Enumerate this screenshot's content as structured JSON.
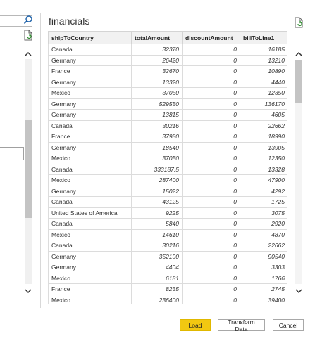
{
  "preview": {
    "title": "financials",
    "columns": [
      "shipToCountry",
      "totalAmount",
      "discountAmount",
      "billToLine1"
    ],
    "rows": [
      [
        "Canada",
        "32370",
        "0",
        "16185"
      ],
      [
        "Germany",
        "26420",
        "0",
        "13210"
      ],
      [
        "France",
        "32670",
        "0",
        "10890"
      ],
      [
        "Germany",
        "13320",
        "0",
        "4440"
      ],
      [
        "Mexico",
        "37050",
        "0",
        "12350"
      ],
      [
        "Germany",
        "529550",
        "0",
        "136170"
      ],
      [
        "Germany",
        "13815",
        "0",
        "4605"
      ],
      [
        "Canada",
        "30216",
        "0",
        "22662"
      ],
      [
        "France",
        "37980",
        "0",
        "18990"
      ],
      [
        "Germany",
        "18540",
        "0",
        "13905"
      ],
      [
        "Mexico",
        "37050",
        "0",
        "12350"
      ],
      [
        "Canada",
        "333187.5",
        "0",
        "13328"
      ],
      [
        "Mexico",
        "287400",
        "0",
        "47900"
      ],
      [
        "Germany",
        "15022",
        "0",
        "4292"
      ],
      [
        "Canada",
        "43125",
        "0",
        "1725"
      ],
      [
        "United States of America",
        "9225",
        "0",
        "3075"
      ],
      [
        "Canada",
        "5840",
        "0",
        "2920"
      ],
      [
        "Mexico",
        "14610",
        "0",
        "4870"
      ],
      [
        "Canada",
        "30216",
        "0",
        "22662"
      ],
      [
        "Germany",
        "352100",
        "0",
        "90540"
      ],
      [
        "Germany",
        "4404",
        "0",
        "3303"
      ],
      [
        "Mexico",
        "6181",
        "0",
        "1766"
      ],
      [
        "France",
        "8235",
        "0",
        "2745"
      ],
      [
        "Mexico",
        "236400",
        "0",
        "39400"
      ]
    ]
  },
  "buttons": {
    "load_label": "Load",
    "transform_label": "Transform Data",
    "cancel_label": "Cancel"
  },
  "colors": {
    "load_button": "#f2c811",
    "header_background": "#f1f1f1",
    "border": "#d4d4d4"
  },
  "icons": [
    "search-icon",
    "refresh-icon",
    "chevron-up-icon",
    "chevron-down-icon"
  ]
}
